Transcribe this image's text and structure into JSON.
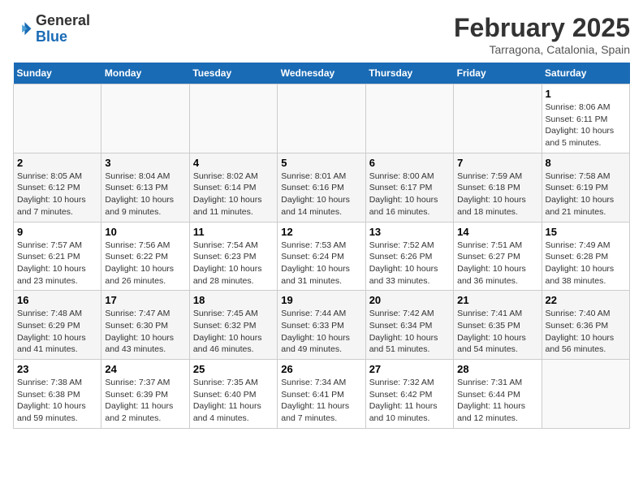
{
  "logo": {
    "line1": "General",
    "line2": "Blue"
  },
  "title": "February 2025",
  "location": "Tarragona, Catalonia, Spain",
  "weekdays": [
    "Sunday",
    "Monday",
    "Tuesday",
    "Wednesday",
    "Thursday",
    "Friday",
    "Saturday"
  ],
  "weeks": [
    [
      {
        "day": "",
        "text": ""
      },
      {
        "day": "",
        "text": ""
      },
      {
        "day": "",
        "text": ""
      },
      {
        "day": "",
        "text": ""
      },
      {
        "day": "",
        "text": ""
      },
      {
        "day": "",
        "text": ""
      },
      {
        "day": "1",
        "text": "Sunrise: 8:06 AM\nSunset: 6:11 PM\nDaylight: 10 hours\nand 5 minutes."
      }
    ],
    [
      {
        "day": "2",
        "text": "Sunrise: 8:05 AM\nSunset: 6:12 PM\nDaylight: 10 hours\nand 7 minutes."
      },
      {
        "day": "3",
        "text": "Sunrise: 8:04 AM\nSunset: 6:13 PM\nDaylight: 10 hours\nand 9 minutes."
      },
      {
        "day": "4",
        "text": "Sunrise: 8:02 AM\nSunset: 6:14 PM\nDaylight: 10 hours\nand 11 minutes."
      },
      {
        "day": "5",
        "text": "Sunrise: 8:01 AM\nSunset: 6:16 PM\nDaylight: 10 hours\nand 14 minutes."
      },
      {
        "day": "6",
        "text": "Sunrise: 8:00 AM\nSunset: 6:17 PM\nDaylight: 10 hours\nand 16 minutes."
      },
      {
        "day": "7",
        "text": "Sunrise: 7:59 AM\nSunset: 6:18 PM\nDaylight: 10 hours\nand 18 minutes."
      },
      {
        "day": "8",
        "text": "Sunrise: 7:58 AM\nSunset: 6:19 PM\nDaylight: 10 hours\nand 21 minutes."
      }
    ],
    [
      {
        "day": "9",
        "text": "Sunrise: 7:57 AM\nSunset: 6:21 PM\nDaylight: 10 hours\nand 23 minutes."
      },
      {
        "day": "10",
        "text": "Sunrise: 7:56 AM\nSunset: 6:22 PM\nDaylight: 10 hours\nand 26 minutes."
      },
      {
        "day": "11",
        "text": "Sunrise: 7:54 AM\nSunset: 6:23 PM\nDaylight: 10 hours\nand 28 minutes."
      },
      {
        "day": "12",
        "text": "Sunrise: 7:53 AM\nSunset: 6:24 PM\nDaylight: 10 hours\nand 31 minutes."
      },
      {
        "day": "13",
        "text": "Sunrise: 7:52 AM\nSunset: 6:26 PM\nDaylight: 10 hours\nand 33 minutes."
      },
      {
        "day": "14",
        "text": "Sunrise: 7:51 AM\nSunset: 6:27 PM\nDaylight: 10 hours\nand 36 minutes."
      },
      {
        "day": "15",
        "text": "Sunrise: 7:49 AM\nSunset: 6:28 PM\nDaylight: 10 hours\nand 38 minutes."
      }
    ],
    [
      {
        "day": "16",
        "text": "Sunrise: 7:48 AM\nSunset: 6:29 PM\nDaylight: 10 hours\nand 41 minutes."
      },
      {
        "day": "17",
        "text": "Sunrise: 7:47 AM\nSunset: 6:30 PM\nDaylight: 10 hours\nand 43 minutes."
      },
      {
        "day": "18",
        "text": "Sunrise: 7:45 AM\nSunset: 6:32 PM\nDaylight: 10 hours\nand 46 minutes."
      },
      {
        "day": "19",
        "text": "Sunrise: 7:44 AM\nSunset: 6:33 PM\nDaylight: 10 hours\nand 49 minutes."
      },
      {
        "day": "20",
        "text": "Sunrise: 7:42 AM\nSunset: 6:34 PM\nDaylight: 10 hours\nand 51 minutes."
      },
      {
        "day": "21",
        "text": "Sunrise: 7:41 AM\nSunset: 6:35 PM\nDaylight: 10 hours\nand 54 minutes."
      },
      {
        "day": "22",
        "text": "Sunrise: 7:40 AM\nSunset: 6:36 PM\nDaylight: 10 hours\nand 56 minutes."
      }
    ],
    [
      {
        "day": "23",
        "text": "Sunrise: 7:38 AM\nSunset: 6:38 PM\nDaylight: 10 hours\nand 59 minutes."
      },
      {
        "day": "24",
        "text": "Sunrise: 7:37 AM\nSunset: 6:39 PM\nDaylight: 11 hours\nand 2 minutes."
      },
      {
        "day": "25",
        "text": "Sunrise: 7:35 AM\nSunset: 6:40 PM\nDaylight: 11 hours\nand 4 minutes."
      },
      {
        "day": "26",
        "text": "Sunrise: 7:34 AM\nSunset: 6:41 PM\nDaylight: 11 hours\nand 7 minutes."
      },
      {
        "day": "27",
        "text": "Sunrise: 7:32 AM\nSunset: 6:42 PM\nDaylight: 11 hours\nand 10 minutes."
      },
      {
        "day": "28",
        "text": "Sunrise: 7:31 AM\nSunset: 6:44 PM\nDaylight: 11 hours\nand 12 minutes."
      },
      {
        "day": "",
        "text": ""
      }
    ]
  ]
}
